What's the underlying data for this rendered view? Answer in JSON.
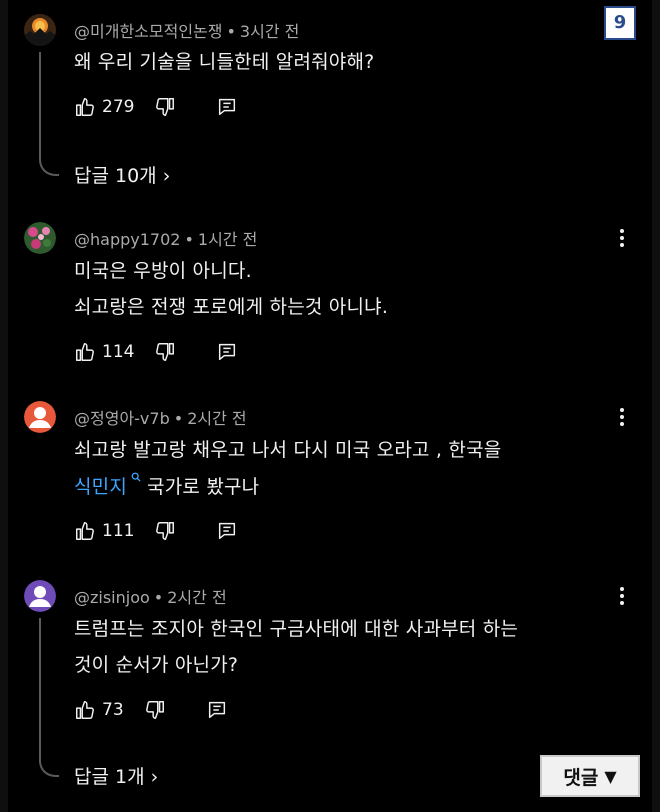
{
  "page_badge": "9",
  "comments": [
    {
      "handle": "@미개한소모적인논쟁",
      "time": "3시간 전",
      "lines": [
        "왜 우리 기술을 니들한테 알려줘야해?"
      ],
      "likes": "279",
      "replies_label": "답글 10개 ›"
    },
    {
      "handle": "@happy1702",
      "time": "1시간 전",
      "lines": [
        "미국은 우방이 아니다.",
        "쇠고랑은 전쟁 포로에게 하는것 아니냐."
      ],
      "likes": "114"
    },
    {
      "handle": "@정영아-v7b",
      "time": "2시간 전",
      "line1": "쇠고랑 발고랑 채우고 나서  다시 미국 오라고 , 한국을",
      "link_text": "식민지",
      "line2_rest": "국가로 봤구나",
      "likes": "111",
      "avatar_color": "#e8583a"
    },
    {
      "handle": "@zisinjoo",
      "time": "2시간 전",
      "lines": [
        "트럼프는 조지아 한국인 구금사태에 대한 사과부터 하는",
        "것이 순서가 아닌가?"
      ],
      "likes": "73",
      "replies_label": "답글 1개 ›",
      "avatar_color": "#6f4bb8"
    }
  ],
  "separator": "•",
  "reply_button": {
    "label": "댓글",
    "arrow": "▼"
  },
  "icons": {
    "like": "thumbs-up-icon",
    "dislike": "thumbs-down-icon",
    "reply": "comment-icon",
    "menu": "more-vert-icon",
    "search": "search-icon"
  }
}
